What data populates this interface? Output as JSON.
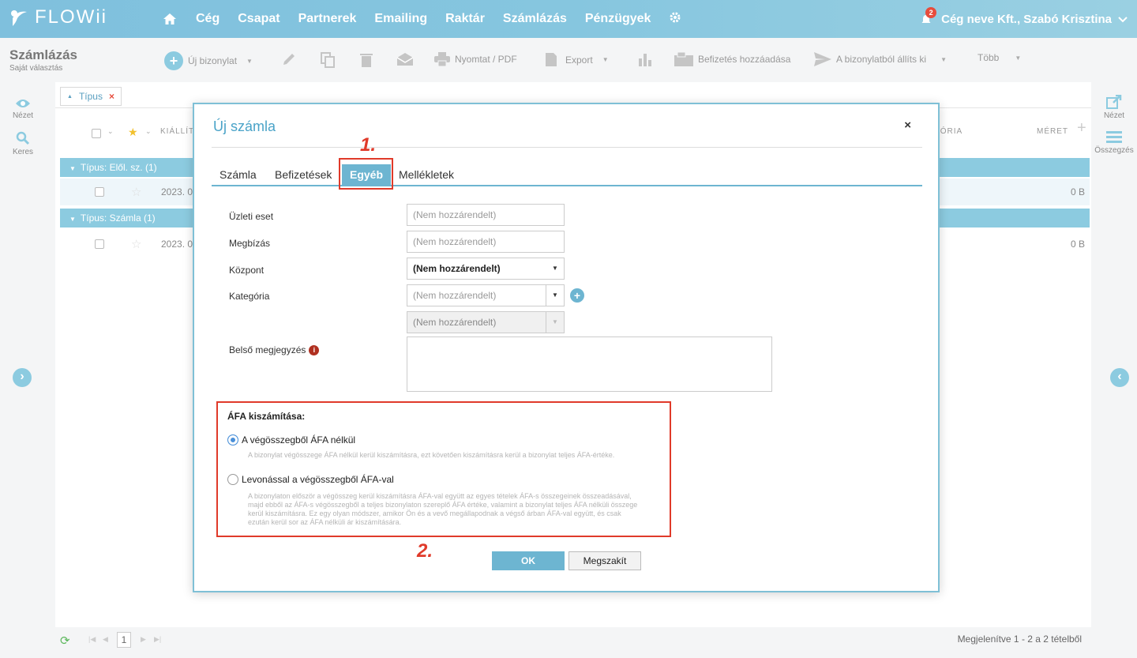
{
  "app": {
    "logo_text": "FLOWii",
    "nav": [
      "Cég",
      "Csapat",
      "Partnerek",
      "Emailing",
      "Raktár",
      "Számlázás",
      "Pénzügyek"
    ],
    "notification_count": "2",
    "user": "Cég neve Kft., Szabó Krisztina"
  },
  "toolbar": {
    "title": "Számlázás",
    "subtitle": "Saját választás",
    "new_doc": "Új bizonylat",
    "print": "Nyomtat / PDF",
    "export": "Export",
    "add_payment": "Befizetés hozzáadása",
    "create_from": "A bizonylatból állíts ki",
    "more": "Több"
  },
  "rails": {
    "left": [
      {
        "label": "Nézet"
      },
      {
        "label": "Keres"
      }
    ],
    "right": [
      {
        "label": "Nézet"
      },
      {
        "label": "Összegzés"
      }
    ]
  },
  "list": {
    "filter_chip": "Típus",
    "col_issuer": "KIÁLLÍTÓ",
    "col_category": "GÓRIA",
    "col_size": "MÉRET",
    "groups": [
      {
        "label": "Típus: Elől. sz. (1)",
        "row": {
          "date": "2023. 0",
          "size": "0 B"
        }
      },
      {
        "label": "Típus: Számla (1)",
        "row": {
          "date": "2023. 0",
          "size": "0 B"
        }
      }
    ]
  },
  "footer": {
    "page": "1",
    "summary": "Megjelenítve 1 - 2 a 2 tételből"
  },
  "modal": {
    "title": "Új számla",
    "close": "×",
    "tabs": [
      "Számla",
      "Befizetések",
      "Egyéb",
      "Mellékletek"
    ],
    "active_tab": "Egyéb",
    "fields": {
      "business_case": {
        "label": "Üzleti eset",
        "placeholder": "(Nem hozzárendelt)"
      },
      "assignment": {
        "label": "Megbízás",
        "placeholder": "(Nem hozzárendelt)"
      },
      "center": {
        "label": "Központ",
        "value": "(Nem hozzárendelt)"
      },
      "category": {
        "label": "Kategória",
        "placeholder": "(Nem hozzárendelt)"
      },
      "subcategory": {
        "placeholder": "(Nem hozzárendelt)"
      },
      "internal_note": {
        "label": "Belső megjegyzés"
      }
    },
    "vat": {
      "title": "ÁFA kiszámítása:",
      "options": [
        {
          "label": "A végösszegből ÁFA nélkül",
          "selected": true,
          "description": "A bizonylat végösszege ÁFA nélkül kerül kiszámításra, ezt követően kiszámításra kerül a bizonylat teljes ÁFA-értéke."
        },
        {
          "label": "Levonással a végösszegből ÁFA-val",
          "selected": false,
          "description": "A bizonylaton először a végösszeg kerül kiszámításra ÁFA-val együtt az egyes tételek ÁFA-s összegeinek összeadásával, majd ebből az ÁFA-s végösszegből a teljes bizonylaton szereplő ÁFA értéke, valamint a bizonylat teljes ÁFA nélküli összege kerül kiszámításra. Ez egy olyan módszer, amikor Ön és a vevő megállapodnak a végső árban ÁFA-val együtt, és csak ezután kerül sor az ÁFA nélküli ár kiszámítására."
        }
      ]
    },
    "ok": "OK",
    "cancel": "Megszakít"
  },
  "annotations": {
    "step1": "1.",
    "step2": "2."
  },
  "colors": {
    "accent": "#6db5d1",
    "header": "#86c6df",
    "annotation": "#e03a2a",
    "radio_selected": "#4a90d9"
  }
}
